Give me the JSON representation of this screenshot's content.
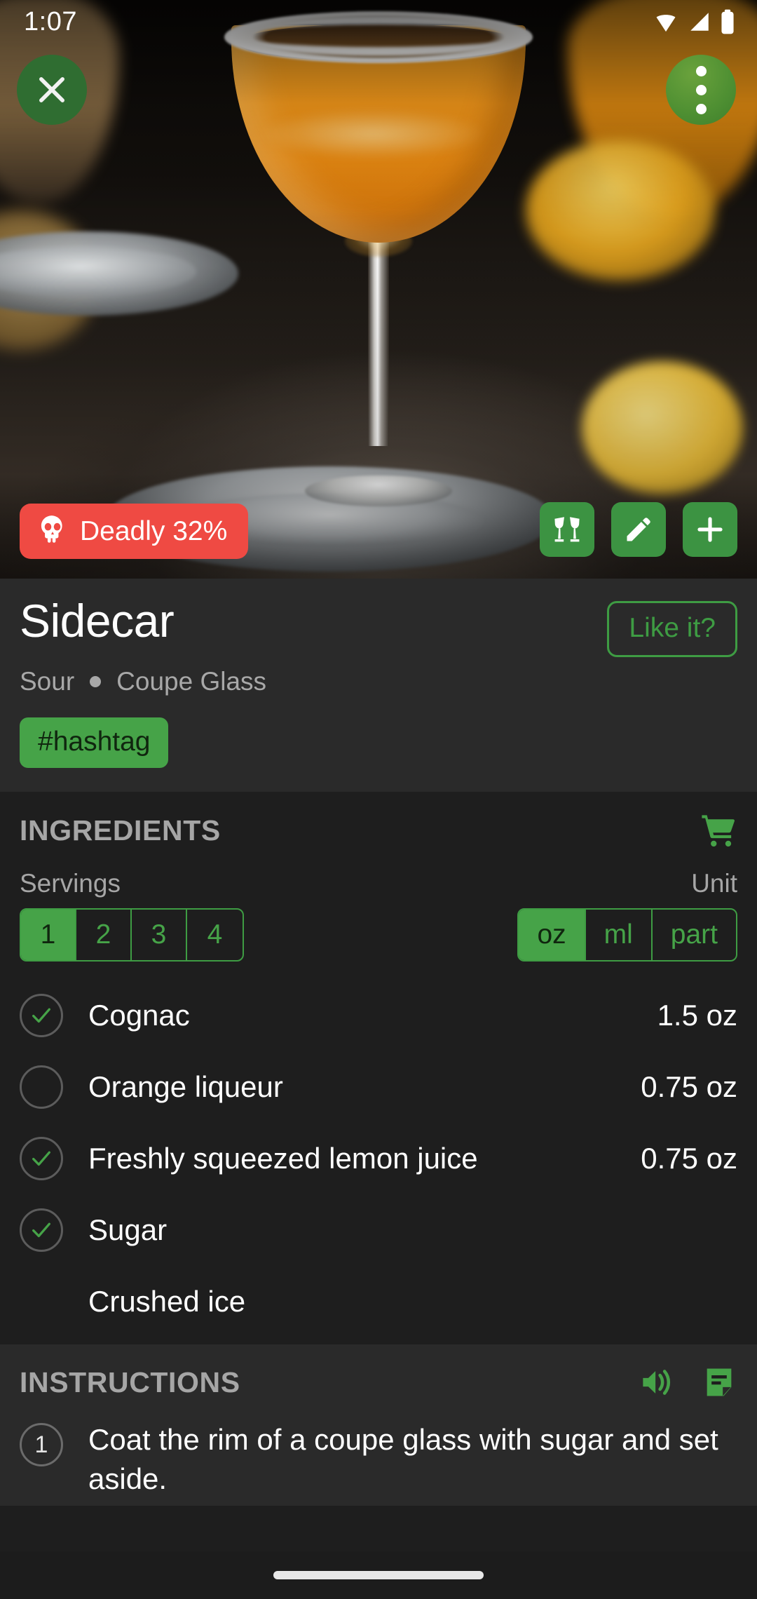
{
  "status_bar": {
    "time": "1:07",
    "icons": [
      "wifi-icon",
      "cellular-signal-icon",
      "battery-icon"
    ]
  },
  "hero": {
    "close_button": {
      "name": "close-icon",
      "glyph": "×"
    },
    "overflow_button": {
      "name": "more-vertical-icon"
    },
    "abv_badge": {
      "label": "Deadly 32%",
      "icon": "skull-icon",
      "color": "#ef4a43"
    },
    "actions": [
      {
        "name": "cheers-button",
        "icon": "cheers-glasses-icon"
      },
      {
        "name": "edit-button",
        "icon": "pencil-icon"
      },
      {
        "name": "add-button",
        "icon": "plus-icon"
      }
    ]
  },
  "title_card": {
    "title": "Sidecar",
    "like_label": "Like it?",
    "category": "Sour",
    "glass": "Coupe Glass",
    "tags": [
      "#hashtag"
    ]
  },
  "ingredients": {
    "heading": "INGREDIENTS",
    "cart_icon": "shopping-cart-icon",
    "servings_label": "Servings",
    "unit_label": "Unit",
    "servings_options": [
      "1",
      "2",
      "3",
      "4"
    ],
    "servings_selected": "1",
    "unit_options": [
      "oz",
      "ml",
      "part"
    ],
    "unit_selected": "oz",
    "items": [
      {
        "name": "Cognac",
        "amount": "1.5 oz",
        "checked": true,
        "has_checkbox": true
      },
      {
        "name": "Orange liqueur",
        "amount": "0.75 oz",
        "checked": false,
        "has_checkbox": true
      },
      {
        "name": "Freshly squeezed lemon juice",
        "amount": "0.75 oz",
        "checked": true,
        "has_checkbox": true
      },
      {
        "name": "Sugar",
        "amount": "",
        "checked": true,
        "has_checkbox": true
      },
      {
        "name": "Crushed ice",
        "amount": "",
        "checked": false,
        "has_checkbox": false
      }
    ]
  },
  "instructions": {
    "heading": "INSTRUCTIONS",
    "speaker_icon": "speaker-volume-icon",
    "note_icon": "note-document-icon",
    "steps": [
      {
        "number": "1",
        "text": "Coat the rim of a coupe glass with sugar and set aside."
      }
    ]
  },
  "nav_bar": {
    "home_indicator": "home-indicator"
  },
  "colors": {
    "accent_green": "#46a348",
    "accent_green_dark": "#3e9c43",
    "danger_red": "#ef4a43",
    "bg_dark": "#1e1e1e",
    "bg_card": "#2a2a2a",
    "text_primary": "#ffffff",
    "text_secondary": "#a6a6a6"
  }
}
